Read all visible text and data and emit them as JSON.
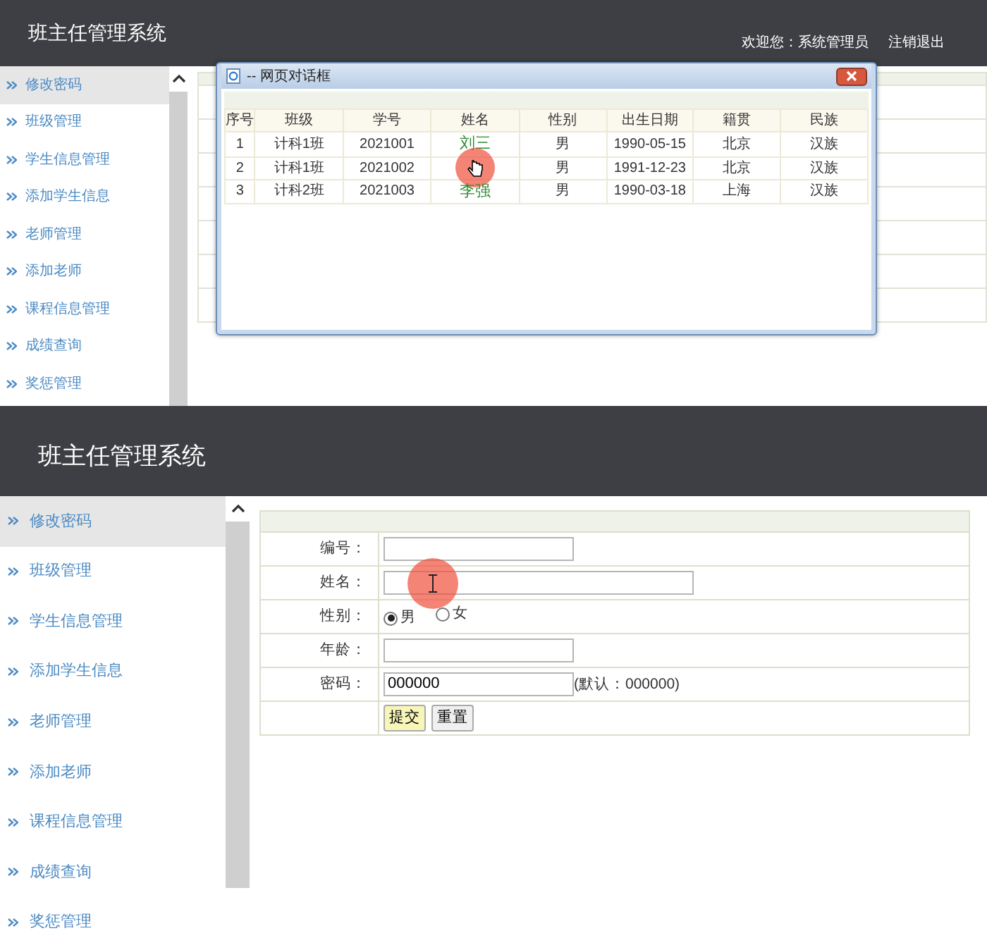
{
  "top_view": {
    "header": {
      "title": "班主任管理系统",
      "welcome": "欢迎您：系统管理员",
      "logout": "注销退出"
    },
    "sidebar": {
      "items": [
        {
          "label": "修改密码",
          "selected": true
        },
        {
          "label": "班级管理",
          "selected": false
        },
        {
          "label": "学生信息管理",
          "selected": false
        },
        {
          "label": "添加学生信息",
          "selected": false
        },
        {
          "label": "老师管理",
          "selected": false
        },
        {
          "label": "添加老师",
          "selected": false
        },
        {
          "label": "课程信息管理",
          "selected": false
        },
        {
          "label": "成绩查询",
          "selected": false
        },
        {
          "label": "奖惩管理",
          "selected": false
        }
      ]
    },
    "dialog": {
      "title": "-- 网页对话框",
      "columns": [
        "序号",
        "班级",
        "学号",
        "姓名",
        "性别",
        "出生日期",
        "籍贯",
        "民族"
      ],
      "rows": [
        {
          "no": "1",
          "class": "计科1班",
          "student_id": "2021001",
          "name": "刘三",
          "gender": "男",
          "birth_date": "1990-05-15",
          "origin": "北京",
          "ethnicity": "汉族",
          "click_highlight": false
        },
        {
          "no": "2",
          "class": "计科1班",
          "student_id": "2021002",
          "gender": "男",
          "birth_date": "1991-12-23",
          "origin": "北京",
          "ethnicity": "汉族",
          "click_highlight": true
        },
        {
          "no": "3",
          "class": "计科2班",
          "student_id": "2021003",
          "name": "李强",
          "gender": "男",
          "birth_date": "1990-03-18",
          "origin": "上海",
          "ethnicity": "汉族",
          "click_highlight": false
        }
      ]
    }
  },
  "bottom_view": {
    "header": {
      "title": "班主任管理系统"
    },
    "sidebar": {
      "items": [
        {
          "label": "修改密码",
          "selected": true
        },
        {
          "label": "班级管理",
          "selected": false
        },
        {
          "label": "学生信息管理",
          "selected": false
        },
        {
          "label": "添加学生信息",
          "selected": false
        },
        {
          "label": "老师管理",
          "selected": false
        },
        {
          "label": "添加老师",
          "selected": false
        },
        {
          "label": "课程信息管理",
          "selected": false
        },
        {
          "label": "成绩查询",
          "selected": false
        },
        {
          "label": "奖惩管理",
          "selected": false
        }
      ]
    },
    "form": {
      "fields": [
        {
          "kind": "text",
          "label": "编号：",
          "wide": false,
          "click_highlight": false
        },
        {
          "kind": "text",
          "label": "姓名：",
          "wide": true,
          "click_highlight": true
        },
        {
          "kind": "radio",
          "label": "性别：",
          "options": [
            {
              "label": "男",
              "selected": true
            },
            {
              "label": "女",
              "selected": false
            }
          ]
        },
        {
          "kind": "text",
          "label": "年龄：",
          "wide": false,
          "click_highlight": false
        },
        {
          "kind": "text",
          "label": "密码：",
          "wide": false,
          "value": "000000",
          "note": "(默认：000000)",
          "click_highlight": false
        }
      ],
      "buttons": [
        {
          "label": "提交",
          "kind": "primary"
        },
        {
          "label": "重置",
          "kind": "default"
        }
      ]
    }
  }
}
